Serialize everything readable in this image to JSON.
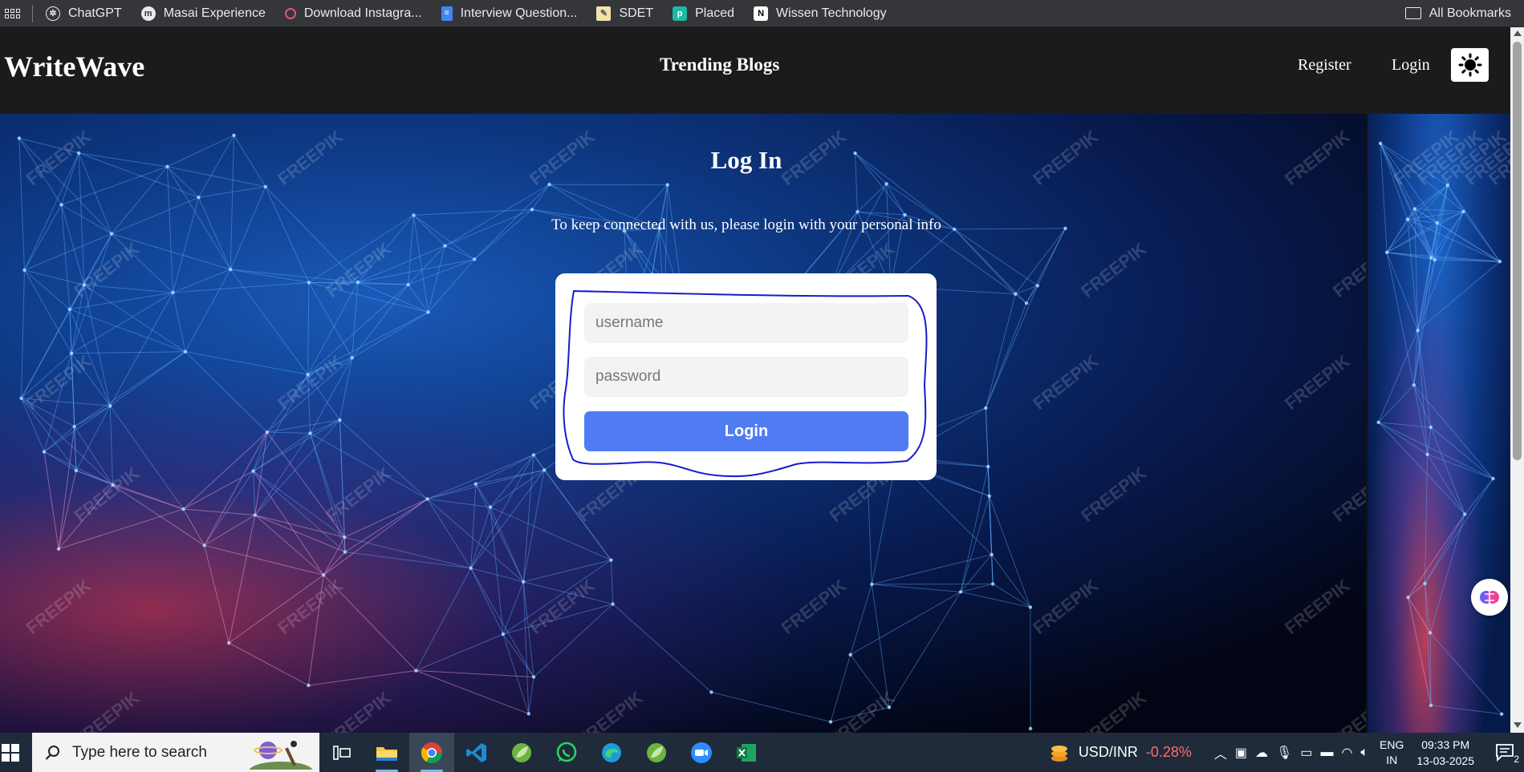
{
  "bookmarks": {
    "items": [
      {
        "label": "ChatGPT",
        "icon": "chatgpt-icon"
      },
      {
        "label": "Masai Experience",
        "icon": "masai-icon"
      },
      {
        "label": "Download Instagra...",
        "icon": "instagram-download-icon"
      },
      {
        "label": "Interview Question...",
        "icon": "docs-icon"
      },
      {
        "label": "SDET",
        "icon": "notes-icon"
      },
      {
        "label": "Placed",
        "icon": "placed-icon"
      },
      {
        "label": "Wissen Technology",
        "icon": "notion-icon"
      }
    ],
    "all_bookmarks": "All Bookmarks"
  },
  "navbar": {
    "brand": "WriteWave",
    "trending": "Trending Blogs",
    "register": "Register",
    "login": "Login"
  },
  "login": {
    "title": "Log In",
    "subtitle": "To keep connected with us, please login with your personal info",
    "username_placeholder": "username",
    "password_placeholder": "password",
    "button": "Login"
  },
  "watermark": "FREEPIK",
  "taskbar": {
    "search_placeholder": "Type here to search",
    "ticker_name": "USD/INR",
    "ticker_change": "-0.28%",
    "lang_line1": "ENG",
    "lang_line2": "IN",
    "time": "09:33 PM",
    "date": "13-03-2025",
    "notification_count": "2",
    "apps": [
      "task-view",
      "file-explorer",
      "chrome",
      "vscode",
      "spring-tool",
      "whatsapp",
      "edge",
      "spring-tool-2",
      "zoom",
      "excel"
    ]
  },
  "colors": {
    "navbar_bg": "#1b1b1b",
    "login_button": "#4f7cf2",
    "annotation_stroke": "#1a1acc",
    "ticker_negative": "#ff6b6b"
  }
}
